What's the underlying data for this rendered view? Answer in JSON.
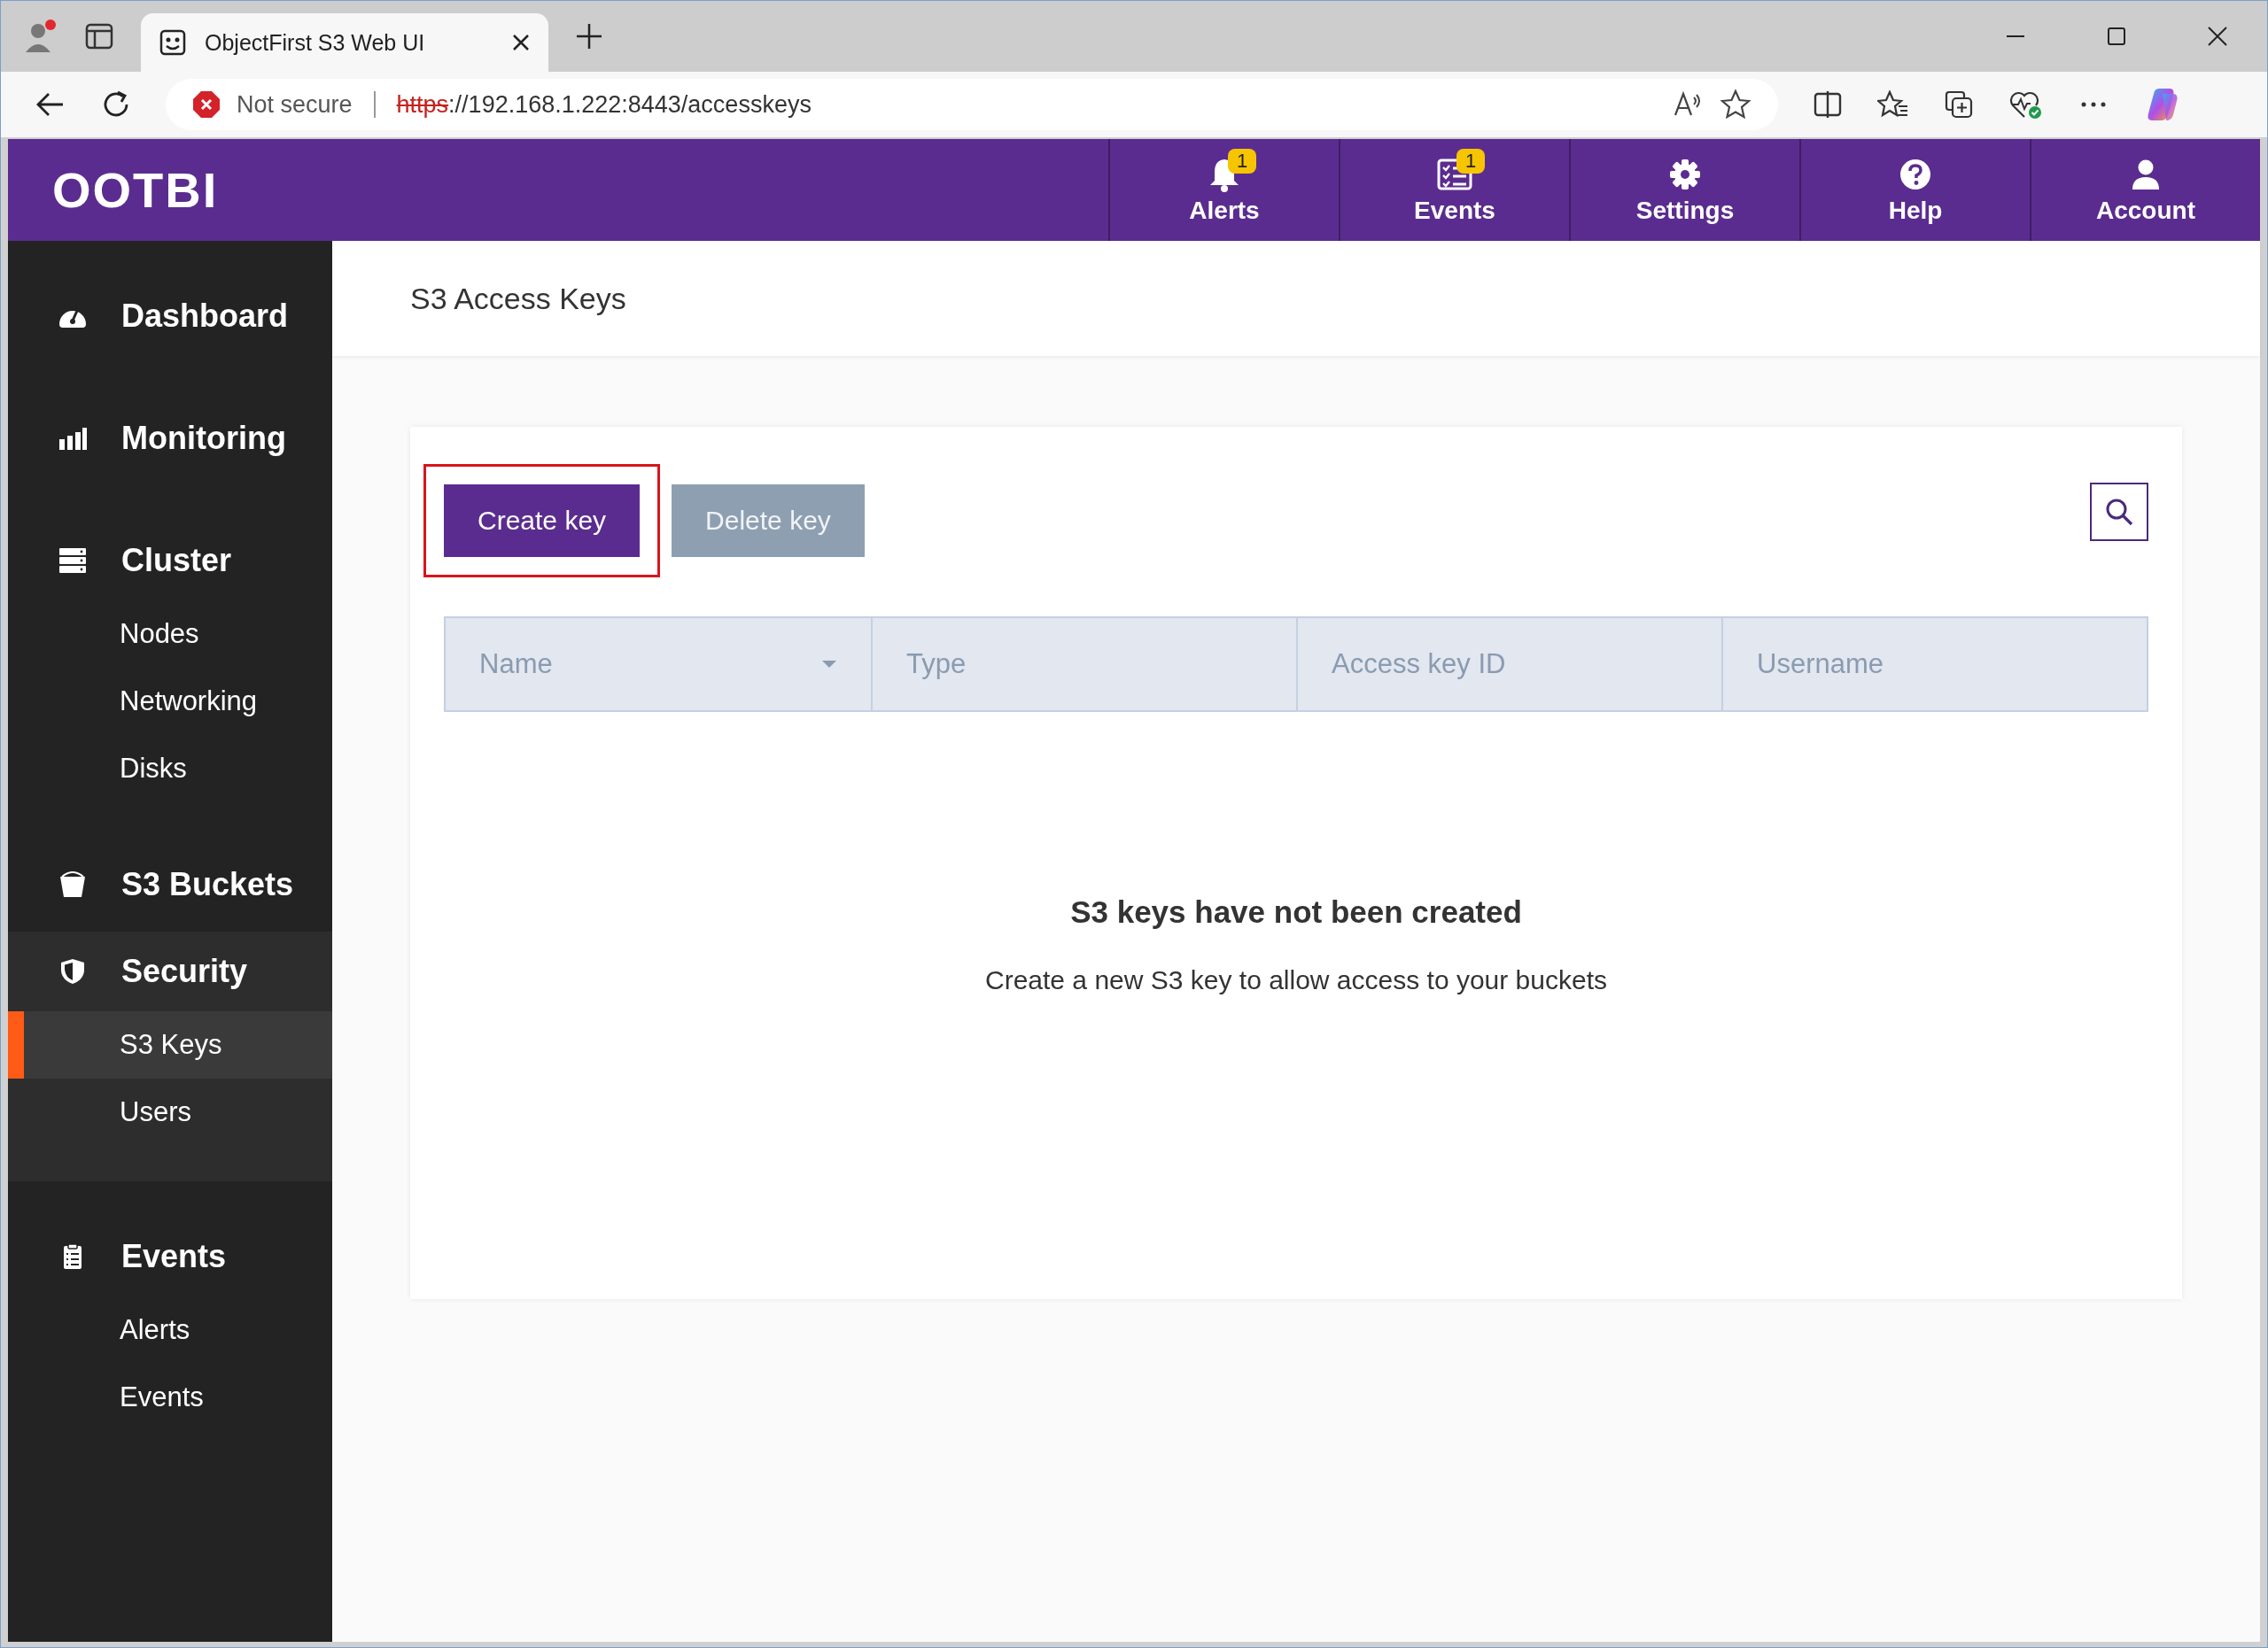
{
  "browser": {
    "tab_title": "ObjectFirst S3 Web UI",
    "security_label": "Not secure",
    "url_scheme": "https",
    "url_rest": "://192.168.1.222:8443/accesskeys",
    "profile_alert": true
  },
  "header": {
    "logo": "OOTBI",
    "nav": [
      {
        "label": "Alerts",
        "badge": "1"
      },
      {
        "label": "Events",
        "badge": "1"
      },
      {
        "label": "Settings"
      },
      {
        "label": "Help"
      },
      {
        "label": "Account"
      }
    ]
  },
  "sidebar": {
    "sections": [
      {
        "label": "Dashboard",
        "selected": false
      },
      {
        "label": "Monitoring",
        "selected": false
      },
      {
        "label": "Cluster",
        "selected": false,
        "children": [
          {
            "label": "Nodes",
            "selected": false
          },
          {
            "label": "Networking",
            "selected": false
          },
          {
            "label": "Disks",
            "selected": false
          }
        ]
      },
      {
        "label": "S3 Buckets",
        "selected": false
      },
      {
        "label": "Security",
        "selected": true,
        "children": [
          {
            "label": "S3 Keys",
            "selected": true
          },
          {
            "label": "Users",
            "selected": false
          }
        ]
      },
      {
        "label": "Events",
        "selected": false,
        "children": [
          {
            "label": "Alerts",
            "selected": false
          },
          {
            "label": "Events",
            "selected": false
          }
        ]
      }
    ]
  },
  "page": {
    "title": "S3 Access Keys",
    "buttons": [
      {
        "label": "Create key",
        "disabled": false,
        "highlighted": true
      },
      {
        "label": "Delete key",
        "disabled": true,
        "highlighted": false
      }
    ],
    "table": {
      "columns": [
        {
          "label": "Name",
          "sorted": true
        },
        {
          "label": "Type",
          "sorted": false
        },
        {
          "label": "Access key ID",
          "sorted": false
        },
        {
          "label": "Username",
          "sorted": false
        }
      ]
    },
    "empty_state": {
      "title": "S3 keys have not been created",
      "message": "Create a new S3 key to allow access to your buckets"
    }
  }
}
